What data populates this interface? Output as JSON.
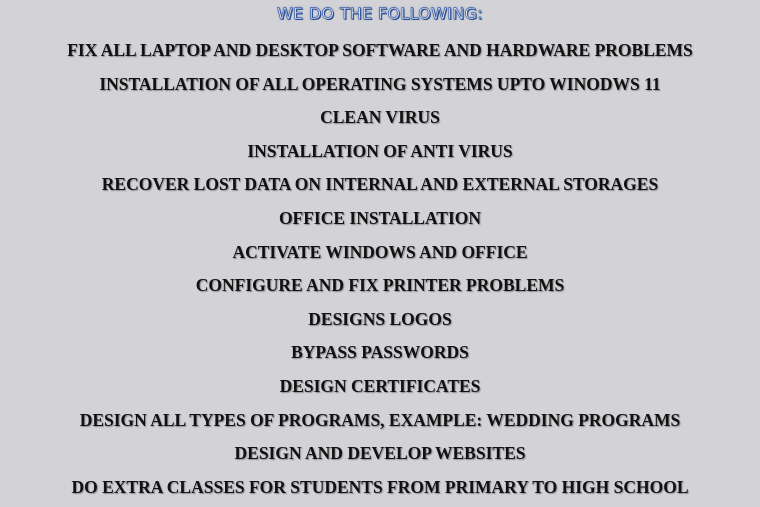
{
  "heading": "WE DO THE FOLLOWING:",
  "services": [
    "FIX ALL LAPTOP AND DESKTOP SOFTWARE AND HARDWARE PROBLEMS",
    "INSTALLATION OF ALL OPERATING SYSTEMS UPTO WINODWS 11",
    "CLEAN VIRUS",
    "INSTALLATION OF ANTI VIRUS",
    "RECOVER LOST DATA ON INTERNAL AND EXTERNAL STORAGES",
    "OFFICE INSTALLATION",
    "ACTIVATE WINDOWS AND OFFICE",
    "CONFIGURE AND FIX PRINTER PROBLEMS",
    "DESIGNS LOGOS",
    "BYPASS PASSWORDS",
    "DESIGN CERTIFICATES",
    "DESIGN ALL TYPES OF PROGRAMS, EXAMPLE: WEDDING PROGRAMS",
    "DESIGN AND DEVELOP WEBSITES",
    "DO EXTRA CLASSES FOR STUDENTS FROM PRIMARY TO HIGH SCHOOL"
  ],
  "colors": {
    "background": "#d3d2d6",
    "heading_fill": "#e9ecf4",
    "heading_outline": "#3a5fa8",
    "text": "#111111"
  }
}
